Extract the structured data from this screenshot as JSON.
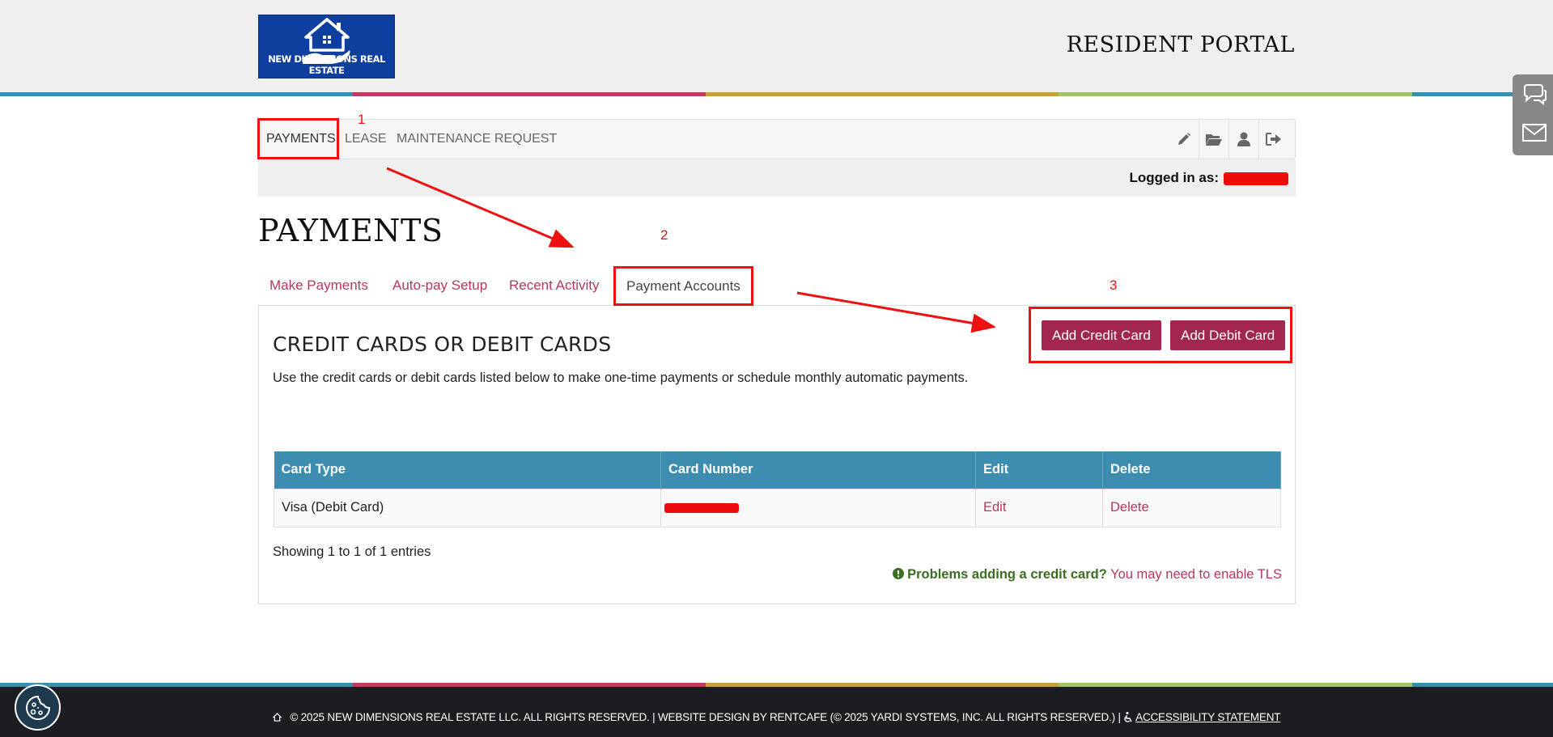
{
  "header": {
    "logo_text": "NEW DIMENSIONS REAL ESTATE",
    "portal_title": "RESIDENT PORTAL"
  },
  "nav": {
    "items": [
      {
        "label": "PAYMENTS"
      },
      {
        "label": "LEASE"
      },
      {
        "label": "MAINTENANCE REQUEST"
      }
    ],
    "icons": [
      "pencil-icon",
      "folder-open-icon",
      "user-icon",
      "sign-out-icon"
    ]
  },
  "logged_in": {
    "label": "Logged in as:"
  },
  "page": {
    "title": "PAYMENTS"
  },
  "tabs": [
    {
      "label": "Make Payments"
    },
    {
      "label": "Auto-pay Setup"
    },
    {
      "label": "Recent Activity"
    },
    {
      "label": "Payment Accounts"
    }
  ],
  "panel": {
    "title": "CREDIT CARDS OR DEBIT CARDS",
    "description": "Use the credit cards or debit cards listed below to make one-time payments or schedule monthly automatic payments.",
    "add_credit_label": "Add Credit Card",
    "add_debit_label": "Add Debit Card"
  },
  "table": {
    "columns": [
      "Card Type",
      "Card Number",
      "Edit",
      "Delete"
    ],
    "rows": [
      {
        "card_type": "Visa (Debit Card)",
        "edit": "Edit",
        "delete": "Delete"
      }
    ],
    "entries_text": "Showing 1 to 1 of 1 entries"
  },
  "tls": {
    "warning": "Problems adding a credit card?",
    "link": "You may need to enable TLS"
  },
  "footer": {
    "text": "© 2025 NEW DIMENSIONS REAL ESTATE LLC. ALL RIGHTS RESERVED. | WEBSITE DESIGN BY RENTCAFE (© 2025 YARDI SYSTEMS, INC. ALL RIGHTS RESERVED.) |",
    "accessibility": "ACCESSIBILITY STATEMENT"
  },
  "annotations": {
    "n1": "1",
    "n2": "2",
    "n3": "3"
  },
  "colors": {
    "accent": "#a2264e",
    "link": "#b8365e",
    "table_header": "#3d8db0",
    "stripe": [
      "#3d8db0",
      "#c0395e",
      "#c9a040",
      "#a2c173",
      "#3d8db0"
    ],
    "annotation": "#ee1111"
  }
}
